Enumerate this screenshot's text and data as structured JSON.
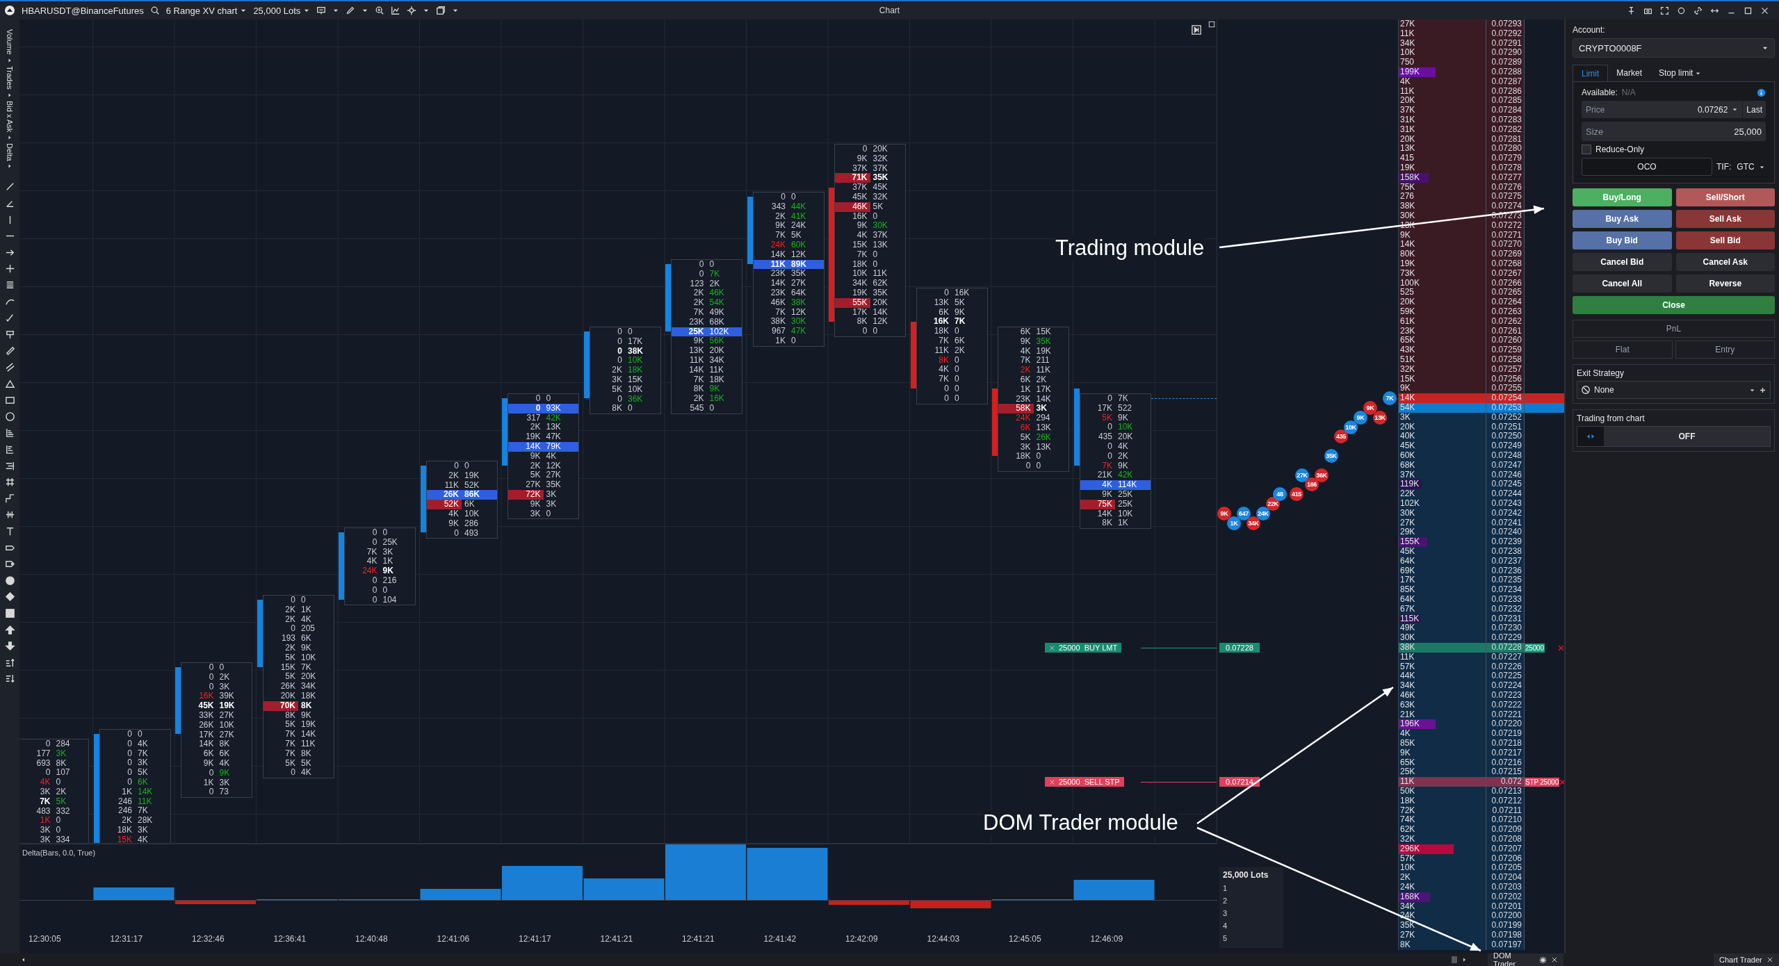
{
  "header": {
    "symbol": "HBARUSDT@BinanceFutures",
    "chart_type": "6 Range XV chart",
    "lots": "25,000 Lots",
    "title": "Chart"
  },
  "indicator_menu": [
    "Volume",
    "Trades",
    "Bid x Ask",
    "Delta"
  ],
  "footprint": [
    {
      "kind": "plain",
      "time": "12:30:05",
      "rows": [
        {
          "bid": "0",
          "ask": "284"
        },
        {
          "bid": "177",
          "ask": "3K",
          "ask_green": true
        },
        {
          "bid": "693",
          "ask": "8K"
        },
        {
          "bid": "0",
          "ask": "107"
        },
        {
          "bid": "4K",
          "bid_red": true,
          "ask": "0"
        },
        {
          "bid": "3K",
          "ask": "2K"
        },
        {
          "bid": "7K",
          "bid_bold": true,
          "ask": "5K",
          "ask_green": true
        },
        {
          "bid": "483",
          "ask": "332"
        },
        {
          "bid": "1K",
          "bid_red": true,
          "ask": "0"
        },
        {
          "bid": "3K",
          "ask": "0"
        },
        {
          "bid": "3K",
          "ask": "334"
        }
      ]
    },
    {
      "kind": "up",
      "time": "12:31:17",
      "rows": [
        {
          "bid": "0",
          "ask": "0"
        },
        {
          "bid": "0",
          "ask": "4K"
        },
        {
          "bid": "0",
          "ask": "7K"
        },
        {
          "bid": "0",
          "ask": "3K"
        },
        {
          "bid": "0",
          "ask": "5K"
        },
        {
          "bid": "0",
          "ask": "6K",
          "ask_green": true
        },
        {
          "bid": "1K",
          "ask": "14K",
          "ask_green": true
        },
        {
          "bid": "246",
          "ask": "11K",
          "ask_green": true
        },
        {
          "bid": "246",
          "ask": "7K"
        },
        {
          "bid": "2K",
          "ask": "28K"
        },
        {
          "bid": "18K",
          "ask": "3K"
        },
        {
          "bid": "15K",
          "bid_red": true,
          "ask": "4K"
        }
      ]
    },
    {
      "kind": "up",
      "time": "12:32:46",
      "rows": [
        {
          "bid": "0",
          "ask": "0"
        },
        {
          "bid": "0",
          "ask": "2K"
        },
        {
          "bid": "0",
          "ask": "3K"
        },
        {
          "bid": "16K",
          "bid_red": true,
          "ask": "39K"
        },
        {
          "bid": "45K",
          "bid_bold": true,
          "ask": "19K",
          "ask_bold": true
        },
        {
          "bid": "33K",
          "ask": "27K"
        },
        {
          "bid": "26K",
          "ask": "10K"
        },
        {
          "bid": "17K",
          "ask": "27K"
        },
        {
          "bid": "14K",
          "ask": "8K"
        },
        {
          "bid": "6K",
          "ask": "6K"
        },
        {
          "bid": "9K",
          "ask": "4K"
        },
        {
          "bid": "0",
          "ask": "9K",
          "ask_green": true
        },
        {
          "bid": "1K",
          "ask": "3K"
        },
        {
          "bid": "0",
          "ask": "73"
        }
      ]
    },
    {
      "kind": "up",
      "time": "12:36:41",
      "rows": [
        {
          "bid": "0",
          "ask": "0"
        },
        {
          "bid": "2K",
          "ask": "1K"
        },
        {
          "bid": "2K",
          "ask": "4K"
        },
        {
          "bid": "0",
          "ask": "205"
        },
        {
          "bid": "193",
          "ask": "6K"
        },
        {
          "bid": "2K",
          "ask": "9K"
        },
        {
          "bid": "5K",
          "ask": "10K"
        },
        {
          "bid": "15K",
          "ask": "7K"
        },
        {
          "bid": "5K",
          "ask": "20K"
        },
        {
          "bid": "26K",
          "ask": "34K"
        },
        {
          "bid": "20K",
          "ask": "18K"
        },
        {
          "bid": "70K",
          "bid_bold": true,
          "ask": "8K",
          "ask_bold": true,
          "fill_red": true
        },
        {
          "bid": "8K",
          "ask": "9K"
        },
        {
          "bid": "5K",
          "ask": "19K"
        },
        {
          "bid": "7K",
          "ask": "14K"
        },
        {
          "bid": "7K",
          "ask": "11K"
        },
        {
          "bid": "7K",
          "ask": "8K"
        },
        {
          "bid": "5K",
          "ask": "5K"
        },
        {
          "bid": "0",
          "ask": "4K"
        }
      ]
    },
    {
      "kind": "up",
      "time": "12:40:48",
      "rows": [
        {
          "bid": "0",
          "ask": "0"
        },
        {
          "bid": "0",
          "ask": "25K"
        },
        {
          "bid": "7K",
          "ask": "3K"
        },
        {
          "bid": "4K",
          "ask": "1K"
        },
        {
          "bid": "24K",
          "bid_red": true,
          "ask": "9K",
          "ask_bold": true
        },
        {
          "bid": "0",
          "ask": "216"
        },
        {
          "bid": "0",
          "ask": "0"
        },
        {
          "bid": "0",
          "ask": "104"
        }
      ]
    },
    {
      "kind": "up",
      "time": "12:41:06",
      "rows": [
        {
          "bid": "0",
          "ask": "0"
        },
        {
          "bid": "2K",
          "ask": "19K"
        },
        {
          "bid": "11K",
          "ask": "52K"
        },
        {
          "bid": "26K",
          "bid_bold": true,
          "ask": "86K",
          "ask_bold": true,
          "fill_blue": true
        },
        {
          "bid": "52K",
          "ask": "6K",
          "fill_red": true
        },
        {
          "bid": "4K",
          "ask": "10K"
        },
        {
          "bid": "9K",
          "ask": "286"
        },
        {
          "bid": "0",
          "ask": "493"
        }
      ]
    },
    {
      "kind": "up",
      "time": "12:41:17",
      "rows": [
        {
          "bid": "0",
          "ask": "0"
        },
        {
          "bid": "0",
          "bid_bold": true,
          "ask": "93K",
          "ask_green": true,
          "fill_blue": true
        },
        {
          "bid": "317",
          "ask": "42K",
          "ask_green": true
        },
        {
          "bid": "2K",
          "ask": "13K"
        },
        {
          "bid": "19K",
          "ask": "47K"
        },
        {
          "bid": "14K",
          "ask": "79K",
          "ask_green": true,
          "fill_blue": true
        },
        {
          "bid": "9K",
          "ask": "4K"
        },
        {
          "bid": "2K",
          "ask": "12K"
        },
        {
          "bid": "5K",
          "ask": "27K"
        },
        {
          "bid": "27K",
          "ask": "35K"
        },
        {
          "bid": "72K",
          "ask": "3K",
          "fill_red": true
        },
        {
          "bid": "9K",
          "ask": "3K"
        },
        {
          "bid": "3K",
          "ask": "0"
        }
      ]
    },
    {
      "kind": "up",
      "time": "12:41:21",
      "rows": [
        {
          "bid": "0",
          "ask": "0"
        },
        {
          "bid": "0",
          "ask": "17K"
        },
        {
          "bid": "0",
          "bid_bold": true,
          "ask": "38K",
          "ask_bold": true
        },
        {
          "bid": "0",
          "ask": "10K",
          "ask_green": true
        },
        {
          "bid": "2K",
          "ask": "18K",
          "ask_green": true
        },
        {
          "bid": "3K",
          "ask": "15K"
        },
        {
          "bid": "5K",
          "ask": "10K"
        },
        {
          "bid": "0",
          "ask": "36K",
          "ask_green": true
        },
        {
          "bid": "8K",
          "ask": "0"
        }
      ]
    },
    {
      "kind": "up",
      "time": "12:41:21",
      "rows": [
        {
          "bid": "0",
          "ask": "0"
        },
        {
          "bid": "0",
          "ask": "7K",
          "ask_green": true
        },
        {
          "bid": "123",
          "ask": "2K"
        },
        {
          "bid": "2K",
          "ask": "46K",
          "ask_green": true
        },
        {
          "bid": "2K",
          "ask": "54K",
          "ask_green": true
        },
        {
          "bid": "7K",
          "ask": "49K"
        },
        {
          "bid": "23K",
          "ask": "68K"
        },
        {
          "bid": "25K",
          "bid_bold": true,
          "ask": "102K",
          "ask_green": true,
          "fill_blue": true
        },
        {
          "bid": "9K",
          "ask": "56K",
          "ask_green": true
        },
        {
          "bid": "13K",
          "ask": "20K"
        },
        {
          "bid": "11K",
          "ask": "34K"
        },
        {
          "bid": "14K",
          "ask": "11K"
        },
        {
          "bid": "7K",
          "ask": "18K"
        },
        {
          "bid": "8K",
          "ask": "9K",
          "ask_green": true
        },
        {
          "bid": "2K",
          "ask": "16K",
          "ask_green": true
        },
        {
          "bid": "545",
          "ask": "0"
        }
      ]
    },
    {
      "kind": "up",
      "time": "12:41:42",
      "rows": [
        {
          "bid": "0",
          "ask": "0"
        },
        {
          "bid": "343",
          "ask": "44K",
          "ask_green": true
        },
        {
          "bid": "2K",
          "ask": "41K",
          "ask_green": true
        },
        {
          "bid": "9K",
          "ask": "24K"
        },
        {
          "bid": "7K",
          "ask": "5K"
        },
        {
          "bid": "24K",
          "bid_red": true,
          "ask": "60K",
          "ask_green": true
        },
        {
          "bid": "14K",
          "ask": "12K"
        },
        {
          "bid": "11K",
          "bid_bold": true,
          "ask": "89K",
          "ask_bold": true,
          "fill_blue": true
        },
        {
          "bid": "23K",
          "ask": "35K"
        },
        {
          "bid": "14K",
          "ask": "27K"
        },
        {
          "bid": "23K",
          "ask": "64K"
        },
        {
          "bid": "46K",
          "ask": "38K",
          "ask_green": true
        },
        {
          "bid": "7K",
          "ask": "12K"
        },
        {
          "bid": "38K",
          "ask": "30K",
          "ask_green": true
        },
        {
          "bid": "967",
          "ask": "47K",
          "ask_green": true
        },
        {
          "bid": "1K",
          "ask": "0"
        }
      ]
    },
    {
      "kind": "down",
      "time": "12:42:09",
      "rows": [
        {
          "bid": "0",
          "ask": "20K"
        },
        {
          "bid": "9K",
          "ask": "32K"
        },
        {
          "bid": "37K",
          "ask": "37K"
        },
        {
          "bid": "71K",
          "bid_bold": true,
          "ask": "35K",
          "ask_bold": true,
          "fill_red": true
        },
        {
          "bid": "37K",
          "ask": "45K"
        },
        {
          "bid": "45K",
          "ask": "32K"
        },
        {
          "bid": "46K",
          "ask": "5K",
          "fill_red": true
        },
        {
          "bid": "16K",
          "ask": "0"
        },
        {
          "bid": "9K",
          "ask": "30K",
          "ask_green": true
        },
        {
          "bid": "4K",
          "ask": "37K"
        },
        {
          "bid": "15K",
          "ask": "13K"
        },
        {
          "bid": "7K",
          "ask": "0"
        },
        {
          "bid": "18K",
          "ask": "0"
        },
        {
          "bid": "10K",
          "ask": "11K"
        },
        {
          "bid": "34K",
          "ask": "62K"
        },
        {
          "bid": "19K",
          "ask": "35K"
        },
        {
          "bid": "55K",
          "ask": "20K",
          "fill_red": true
        },
        {
          "bid": "17K",
          "ask": "14K"
        },
        {
          "bid": "8K",
          "ask": "12K"
        },
        {
          "bid": "0",
          "ask": "0"
        }
      ]
    },
    {
      "kind": "down",
      "time": "12:44:03",
      "rows": [
        {
          "bid": "0",
          "ask": "16K"
        },
        {
          "bid": "13K",
          "ask": "5K"
        },
        {
          "bid": "6K",
          "ask": "9K"
        },
        {
          "bid": "16K",
          "bid_bold": true,
          "ask": "7K",
          "ask_bold": true
        },
        {
          "bid": "18K",
          "ask": "0"
        },
        {
          "bid": "7K",
          "ask": "6K"
        },
        {
          "bid": "11K",
          "ask": "2K"
        },
        {
          "bid": "8K",
          "bid_red": true,
          "ask": "0"
        },
        {
          "bid": "4K",
          "ask": "0"
        },
        {
          "bid": "7K",
          "ask": "0"
        },
        {
          "bid": "0",
          "ask": "0"
        },
        {
          "bid": "0",
          "ask": "0"
        }
      ]
    },
    {
      "kind": "down",
      "time": "12:45:05",
      "rows": [
        {
          "bid": "6K",
          "ask": "15K"
        },
        {
          "bid": "9K",
          "ask": "35K",
          "ask_green": true
        },
        {
          "bid": "4K",
          "ask": "19K"
        },
        {
          "bid": "7K",
          "ask": "211"
        },
        {
          "bid": "2K",
          "bid_red": true,
          "ask": "11K"
        },
        {
          "bid": "6K",
          "ask": "2K"
        },
        {
          "bid": "1K",
          "ask": "17K"
        },
        {
          "bid": "23K",
          "ask": "14K"
        },
        {
          "bid": "58K",
          "bid_red": true,
          "ask": "3K",
          "ask_bold": true,
          "fill_red": true
        },
        {
          "bid": "24K",
          "bid_red": true,
          "ask": "294"
        },
        {
          "bid": "6K",
          "bid_red": true,
          "ask": "13K"
        },
        {
          "bid": "5K",
          "ask": "26K",
          "ask_green": true
        },
        {
          "bid": "3K",
          "ask": "13K"
        },
        {
          "bid": "18K",
          "ask": "0"
        },
        {
          "bid": "0",
          "ask": "0"
        }
      ]
    },
    {
      "kind": "up",
      "time": "12:46:09",
      "rows": [
        {
          "bid": "0",
          "ask": "7K"
        },
        {
          "bid": "17K",
          "ask": "522"
        },
        {
          "bid": "5K",
          "bid_red": true,
          "ask": "9K"
        },
        {
          "bid": "0",
          "ask": "10K",
          "ask_green": true
        },
        {
          "bid": "435",
          "ask": "20K"
        },
        {
          "bid": "0",
          "ask": "4K"
        },
        {
          "bid": "0",
          "ask": "2K"
        },
        {
          "bid": "7K",
          "bid_red": true,
          "ask": "9K"
        },
        {
          "bid": "21K",
          "ask": "42K",
          "ask_green": true
        },
        {
          "bid": "4K",
          "ask": "114K",
          "ask_green": true,
          "fill_blue": true
        },
        {
          "bid": "9K",
          "ask": "25K"
        },
        {
          "bid": "75K",
          "ask": "25K",
          "fill_red": true
        },
        {
          "bid": "14K",
          "ask": "10K"
        },
        {
          "bid": "8K",
          "ask": "1K"
        }
      ]
    }
  ],
  "chart_orders": [
    {
      "kind": "buy",
      "quantity": "25000",
      "label": "BUY LMT",
      "price": "0.07228"
    },
    {
      "kind": "stop",
      "quantity": "25000",
      "label": "SELL STP",
      "price": "0.07214"
    }
  ],
  "delta_label": "Delta(Bars, 0.0, True)",
  "trades": [
    {
      "size": "9K",
      "kind": "sell"
    },
    {
      "size": "1K",
      "kind": "buy"
    },
    {
      "size": "647",
      "kind": "buy"
    },
    {
      "size": "34K",
      "kind": "sell"
    },
    {
      "size": "24K",
      "kind": "buy"
    },
    {
      "size": "22K",
      "kind": "sell"
    },
    {
      "size": "48",
      "kind": "buy"
    },
    {
      "size": "415",
      "kind": "sell"
    },
    {
      "size": "27K",
      "kind": "buy"
    },
    {
      "size": "166",
      "kind": "sell"
    },
    {
      "size": "36K",
      "kind": "sell"
    },
    {
      "size": "35K",
      "kind": "buy"
    },
    {
      "size": "435",
      "kind": "sell"
    },
    {
      "size": "10K",
      "kind": "buy"
    },
    {
      "size": "9K",
      "kind": "buy"
    },
    {
      "size": "9K",
      "kind": "sell"
    },
    {
      "size": "13K",
      "kind": "sell"
    },
    {
      "size": "7K",
      "kind": "buy"
    }
  ],
  "lots_box": {
    "title": "25,000 Lots",
    "rows": [
      "1",
      "2",
      "3",
      "4",
      "5"
    ]
  },
  "ladder": [
    {
      "price": "0.07293",
      "volume": "27K",
      "kind": "ask"
    },
    {
      "price": "0.07292",
      "volume": "11K",
      "kind": "ask"
    },
    {
      "price": "0.07291",
      "volume": "34K",
      "kind": "ask"
    },
    {
      "price": "0.07290",
      "volume": "10K",
      "kind": "ask"
    },
    {
      "price": "0.07289",
      "volume": "750",
      "kind": "ask"
    },
    {
      "price": "0.07288",
      "volume": "199K",
      "kind": "ask",
      "level": 0.42,
      "color": "#6a0fa0"
    },
    {
      "price": "0.07287",
      "volume": "4K",
      "kind": "ask"
    },
    {
      "price": "0.07286",
      "volume": "11K",
      "kind": "ask"
    },
    {
      "price": "0.07285",
      "volume": "20K",
      "kind": "ask"
    },
    {
      "price": "0.07284",
      "volume": "37K",
      "kind": "ask"
    },
    {
      "price": "0.07283",
      "volume": "31K",
      "kind": "ask"
    },
    {
      "price": "0.07282",
      "volume": "31K",
      "kind": "ask"
    },
    {
      "price": "0.07281",
      "volume": "20K",
      "kind": "ask"
    },
    {
      "price": "0.07280",
      "volume": "13K",
      "kind": "ask"
    },
    {
      "price": "0.07279",
      "volume": "415",
      "kind": "ask"
    },
    {
      "price": "0.07278",
      "volume": "19K",
      "kind": "ask"
    },
    {
      "price": "0.07277",
      "volume": "158K",
      "kind": "ask",
      "level": 0.34,
      "color": "#48106e"
    },
    {
      "price": "0.07276",
      "volume": "75K",
      "kind": "ask"
    },
    {
      "price": "0.07275",
      "volume": "276",
      "kind": "ask"
    },
    {
      "price": "0.07274",
      "volume": "38K",
      "kind": "ask"
    },
    {
      "price": "0.07273",
      "volume": "30K",
      "kind": "ask"
    },
    {
      "price": "0.07272",
      "volume": "13K",
      "kind": "ask"
    },
    {
      "price": "0.07271",
      "volume": "9K",
      "kind": "ask"
    },
    {
      "price": "0.07270",
      "volume": "14K",
      "kind": "ask"
    },
    {
      "price": "0.07269",
      "volume": "80K",
      "kind": "ask"
    },
    {
      "price": "0.07268",
      "volume": "19K",
      "kind": "ask"
    },
    {
      "price": "0.07267",
      "volume": "73K",
      "kind": "ask"
    },
    {
      "price": "0.07266",
      "volume": "100K",
      "kind": "ask"
    },
    {
      "price": "0.07265",
      "volume": "525",
      "kind": "ask"
    },
    {
      "price": "0.07264",
      "volume": "20K",
      "kind": "ask"
    },
    {
      "price": "0.07263",
      "volume": "59K",
      "kind": "ask"
    },
    {
      "price": "0.07262",
      "volume": "61K",
      "kind": "ask"
    },
    {
      "price": "0.07261",
      "volume": "23K",
      "kind": "ask"
    },
    {
      "price": "0.07260",
      "volume": "65K",
      "kind": "ask"
    },
    {
      "price": "0.07259",
      "volume": "43K",
      "kind": "ask"
    },
    {
      "price": "0.07258",
      "volume": "51K",
      "kind": "ask"
    },
    {
      "price": "0.07257",
      "volume": "32K",
      "kind": "ask"
    },
    {
      "price": "0.07256",
      "volume": "15K",
      "kind": "ask"
    },
    {
      "price": "0.07255",
      "volume": "9K",
      "kind": "ask"
    },
    {
      "price": "0.07254",
      "volume": "14K",
      "kind": "bestask"
    },
    {
      "price": "0.07253",
      "volume": "54K",
      "kind": "bestbid"
    },
    {
      "price": "0.07252",
      "volume": "3K",
      "kind": "bid"
    },
    {
      "price": "0.07251",
      "volume": "20K",
      "kind": "bid"
    },
    {
      "price": "0.07250",
      "volume": "40K",
      "kind": "bid"
    },
    {
      "price": "0.07249",
      "volume": "45K",
      "kind": "bid"
    },
    {
      "price": "0.07248",
      "volume": "60K",
      "kind": "bid"
    },
    {
      "price": "0.07247",
      "volume": "68K",
      "kind": "bid"
    },
    {
      "price": "0.07246",
      "volume": "37K",
      "kind": "bid"
    },
    {
      "price": "0.07245",
      "volume": "119K",
      "kind": "bid",
      "level": 0.26,
      "color": "#2a1450"
    },
    {
      "price": "0.07244",
      "volume": "22K",
      "kind": "bid"
    },
    {
      "price": "0.07243",
      "volume": "102K",
      "kind": "bid"
    },
    {
      "price": "0.07242",
      "volume": "30K",
      "kind": "bid"
    },
    {
      "price": "0.07241",
      "volume": "27K",
      "kind": "bid"
    },
    {
      "price": "0.07240",
      "volume": "29K",
      "kind": "bid"
    },
    {
      "price": "0.07239",
      "volume": "155K",
      "kind": "bid",
      "level": 0.33,
      "color": "#4a1372"
    },
    {
      "price": "0.07238",
      "volume": "45K",
      "kind": "bid"
    },
    {
      "price": "0.07237",
      "volume": "64K",
      "kind": "bid"
    },
    {
      "price": "0.07236",
      "volume": "69K",
      "kind": "bid"
    },
    {
      "price": "0.07235",
      "volume": "17K",
      "kind": "bid"
    },
    {
      "price": "0.07234",
      "volume": "85K",
      "kind": "bid"
    },
    {
      "price": "0.07233",
      "volume": "64K",
      "kind": "bid"
    },
    {
      "price": "0.07232",
      "volume": "67K",
      "kind": "bid"
    },
    {
      "price": "0.07231",
      "volume": "115K",
      "kind": "bid",
      "level": 0.25,
      "color": "#2c1652"
    },
    {
      "price": "0.07230",
      "volume": "49K",
      "kind": "bid"
    },
    {
      "price": "0.07229",
      "volume": "30K",
      "kind": "bid"
    },
    {
      "price": "0.07228",
      "volume": "38K",
      "kind": "buyorder",
      "order_label": "25000"
    },
    {
      "price": "0.07227",
      "volume": "11K",
      "kind": "bid"
    },
    {
      "price": "0.07226",
      "volume": "57K",
      "kind": "bid"
    },
    {
      "price": "0.07225",
      "volume": "44K",
      "kind": "bid"
    },
    {
      "price": "0.07224",
      "volume": "34K",
      "kind": "bid"
    },
    {
      "price": "0.07223",
      "volume": "46K",
      "kind": "bid"
    },
    {
      "price": "0.07222",
      "volume": "63K",
      "kind": "bid"
    },
    {
      "price": "0.07221",
      "volume": "21K",
      "kind": "bid"
    },
    {
      "price": "0.07220",
      "volume": "196K",
      "kind": "bid",
      "level": 0.42,
      "color": "#6a1296"
    },
    {
      "price": "0.07219",
      "volume": "4K",
      "kind": "bid"
    },
    {
      "price": "0.07218",
      "volume": "85K",
      "kind": "bid"
    },
    {
      "price": "0.07217",
      "volume": "9K",
      "kind": "bid"
    },
    {
      "price": "0.07216",
      "volume": "65K",
      "kind": "bid"
    },
    {
      "price": "0.07215",
      "volume": "25K",
      "kind": "bid"
    },
    {
      "price": "0.072",
      "volume": "11K",
      "kind": "stoporder",
      "order_label": "STP 25000"
    },
    {
      "price": "0.07213",
      "volume": "50K",
      "kind": "bid"
    },
    {
      "price": "0.07212",
      "volume": "18K",
      "kind": "bid"
    },
    {
      "price": "0.07211",
      "volume": "72K",
      "kind": "bid"
    },
    {
      "price": "0.07210",
      "volume": "74K",
      "kind": "bid"
    },
    {
      "price": "0.07209",
      "volume": "62K",
      "kind": "bid"
    },
    {
      "price": "0.07208",
      "volume": "32K",
      "kind": "bid"
    },
    {
      "price": "0.07207",
      "volume": "296K",
      "kind": "bid",
      "level": 0.63,
      "color": "#b8083e"
    },
    {
      "price": "0.07206",
      "volume": "57K",
      "kind": "bid"
    },
    {
      "price": "0.07205",
      "volume": "10K",
      "kind": "bid"
    },
    {
      "price": "0.07204",
      "volume": "2K",
      "kind": "bid"
    },
    {
      "price": "0.07203",
      "volume": "24K",
      "kind": "bid"
    },
    {
      "price": "0.07202",
      "volume": "168K",
      "kind": "bid",
      "level": 0.36,
      "color": "#4c1478"
    },
    {
      "price": "0.07201",
      "volume": "34K",
      "kind": "bid"
    },
    {
      "price": "0.07200",
      "volume": "24K",
      "kind": "bid"
    },
    {
      "price": "0.07199",
      "volume": "35K",
      "kind": "bid"
    },
    {
      "price": "0.07198",
      "volume": "27K",
      "kind": "bid"
    },
    {
      "price": "0.07197",
      "volume": "8K",
      "kind": "bid"
    }
  ],
  "trade_panel": {
    "account_label": "Account:",
    "account": "CRYPTO0008F",
    "tabs": [
      {
        "label": "Limit",
        "selected": true,
        "dropdown": false
      },
      {
        "label": "Market",
        "selected": false,
        "dropdown": false
      },
      {
        "label": "Stop limit",
        "selected": false,
        "dropdown": true
      }
    ],
    "available_label": "Available:",
    "available": "N/A",
    "price_label": "Price",
    "price": "0.07262",
    "price_button": "Last",
    "size_label": "Size",
    "size": "25,000",
    "reduce_only": {
      "label": "Reduce-Only",
      "checked": false
    },
    "oco": "OCO",
    "tif_label": "TIF:",
    "tif": "GTC",
    "buttons": [
      {
        "label": "Buy/Long",
        "kind": "buy"
      },
      {
        "label": "Sell/Short",
        "kind": "sell"
      },
      {
        "label": "Buy Ask",
        "kind": "buyorder"
      },
      {
        "label": "Sell Ask",
        "kind": "sellorder"
      },
      {
        "label": "Buy Bid",
        "kind": "buyorder"
      },
      {
        "label": "Sell Bid",
        "kind": "sellorder"
      },
      {
        "label": "Cancel Bid",
        "kind": "neutral"
      },
      {
        "label": "Cancel Ask",
        "kind": "neutral"
      },
      {
        "label": "Cancel All",
        "kind": "neutral"
      },
      {
        "label": "Reverse",
        "kind": "neutral"
      },
      {
        "label": "Close",
        "kind": "close"
      }
    ],
    "pnl": {
      "label": "PnL",
      "cells": [
        "Flat",
        "Entry"
      ]
    },
    "exit_strategy": {
      "label": "Exit Strategy",
      "value": "None"
    },
    "trading_from_chart": {
      "label": "Trading from chart",
      "state": "OFF",
      "on": false
    }
  },
  "annotations": [
    {
      "text": "Trading module"
    },
    {
      "text": "DOM Trader module"
    }
  ],
  "bottom_tabs": [
    {
      "label": "DOM Trader",
      "settings": true
    },
    {
      "label": "Chart Trader",
      "settings": false
    }
  ]
}
